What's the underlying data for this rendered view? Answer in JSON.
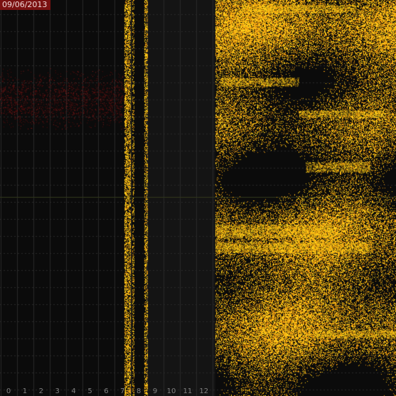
{
  "viewer": {
    "date": "09/06/2013",
    "hour_labels": [
      "0",
      "1",
      "2",
      "3",
      "4",
      "5",
      "6",
      "7",
      "8",
      "9",
      "10",
      "11",
      "12"
    ]
  },
  "colors": {
    "background": "#0b0b0b",
    "grid": "#2a2a2a",
    "date_badge": "#7a1010",
    "low_signal": "#8b1a1a",
    "signal_orange": "#e8960e",
    "signal_yellow": "#ffd21a"
  }
}
